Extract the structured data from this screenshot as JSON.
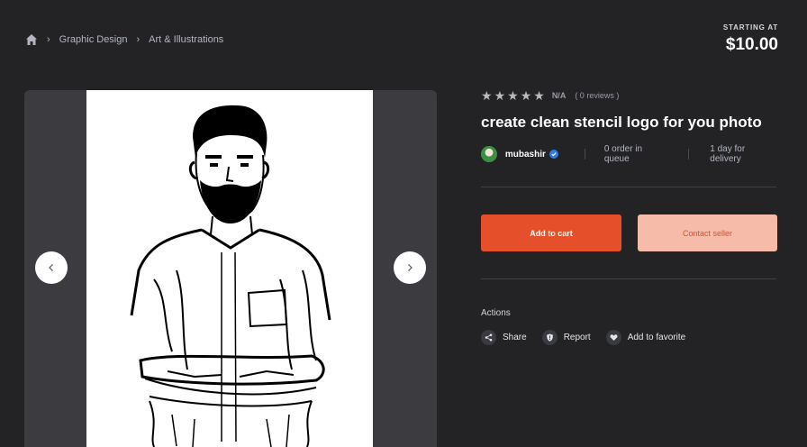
{
  "breadcrumb": {
    "home_icon": "home-icon",
    "items": [
      "Graphic Design",
      "Art & Illustrations"
    ]
  },
  "price": {
    "label": "STARTING AT",
    "value": "$10.00"
  },
  "gallery": {
    "prev_icon": "chevron-left-icon",
    "next_icon": "chevron-right-icon"
  },
  "rating": {
    "stars": 5,
    "score": "N/A",
    "reviews": "( 0 reviews )"
  },
  "gig": {
    "title": "create clean stencil logo for you photo"
  },
  "seller": {
    "name": "mubashir",
    "verified_icon": "verified-badge-icon",
    "queue": "0 order in queue",
    "delivery": "1 day for delivery"
  },
  "buttons": {
    "add_to_cart": "Add to cart",
    "contact_seller": "Contact seller"
  },
  "actions": {
    "label": "Actions",
    "items": [
      {
        "label": "Share",
        "icon": "share-icon"
      },
      {
        "label": "Report",
        "icon": "shield-icon"
      },
      {
        "label": "Add to favorite",
        "icon": "heart-icon"
      }
    ]
  },
  "colors": {
    "background": "#232326",
    "accent": "#e5502a",
    "accent_light": "#f6bba9",
    "verified": "#2f7be8"
  }
}
